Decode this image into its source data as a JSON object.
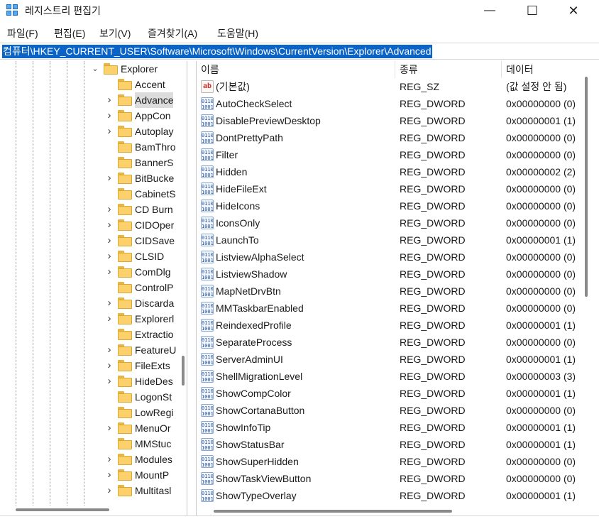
{
  "window": {
    "title": "레지스트리 편집기",
    "controls": {
      "minimize": "—",
      "maximize": "☐",
      "close": "✕"
    }
  },
  "menu": [
    "파일(F)",
    "편집(E)",
    "보기(V)",
    "즐겨찾기(A)",
    "도움말(H)"
  ],
  "address": "컴퓨터\\HKEY_CURRENT_USER\\Software\\Microsoft\\Windows\\CurrentVersion\\Explorer\\Advanced",
  "tree": {
    "parent": {
      "label": "Explorer",
      "expanded": true
    },
    "children": [
      {
        "label": "Accent",
        "expandable": false,
        "selected": false
      },
      {
        "label": "Advance",
        "expandable": true,
        "selected": true
      },
      {
        "label": "AppCon",
        "expandable": true,
        "selected": false
      },
      {
        "label": "Autoplay",
        "expandable": true,
        "selected": false
      },
      {
        "label": "BamThro",
        "expandable": false,
        "selected": false
      },
      {
        "label": "BannerS",
        "expandable": false,
        "selected": false
      },
      {
        "label": "BitBucke",
        "expandable": true,
        "selected": false
      },
      {
        "label": "CabinetS",
        "expandable": false,
        "selected": false
      },
      {
        "label": "CD Burn",
        "expandable": true,
        "selected": false
      },
      {
        "label": "CIDOper",
        "expandable": true,
        "selected": false
      },
      {
        "label": "CIDSave",
        "expandable": true,
        "selected": false
      },
      {
        "label": "CLSID",
        "expandable": true,
        "selected": false
      },
      {
        "label": "ComDlg",
        "expandable": true,
        "selected": false
      },
      {
        "label": "ControlP",
        "expandable": false,
        "selected": false
      },
      {
        "label": "Discarda",
        "expandable": true,
        "selected": false
      },
      {
        "label": "Explorerl",
        "expandable": true,
        "selected": false
      },
      {
        "label": "Extractio",
        "expandable": false,
        "selected": false
      },
      {
        "label": "FeatureU",
        "expandable": true,
        "selected": false
      },
      {
        "label": "FileExts",
        "expandable": true,
        "selected": false
      },
      {
        "label": "HideDes",
        "expandable": true,
        "selected": false
      },
      {
        "label": "LogonSt",
        "expandable": false,
        "selected": false
      },
      {
        "label": "LowRegi",
        "expandable": false,
        "selected": false
      },
      {
        "label": "MenuOr",
        "expandable": true,
        "selected": false
      },
      {
        "label": "MMStuc",
        "expandable": false,
        "selected": false
      },
      {
        "label": "Modules",
        "expandable": true,
        "selected": false
      },
      {
        "label": "MountP",
        "expandable": true,
        "selected": false
      },
      {
        "label": "Multitasl",
        "expandable": true,
        "selected": false
      }
    ]
  },
  "columns": [
    "이름",
    "종류",
    "데이터"
  ],
  "values": [
    {
      "name": "(기본값)",
      "type": "REG_SZ",
      "data": "(값 설정 안 됨)",
      "icon": "string-value-icon"
    },
    {
      "name": "AutoCheckSelect",
      "type": "REG_DWORD",
      "data": "0x00000000 (0)",
      "icon": "binary-value-icon"
    },
    {
      "name": "DisablePreviewDesktop",
      "type": "REG_DWORD",
      "data": "0x00000001 (1)",
      "icon": "binary-value-icon"
    },
    {
      "name": "DontPrettyPath",
      "type": "REG_DWORD",
      "data": "0x00000000 (0)",
      "icon": "binary-value-icon"
    },
    {
      "name": "Filter",
      "type": "REG_DWORD",
      "data": "0x00000000 (0)",
      "icon": "binary-value-icon"
    },
    {
      "name": "Hidden",
      "type": "REG_DWORD",
      "data": "0x00000002 (2)",
      "icon": "binary-value-icon"
    },
    {
      "name": "HideFileExt",
      "type": "REG_DWORD",
      "data": "0x00000000 (0)",
      "icon": "binary-value-icon"
    },
    {
      "name": "HideIcons",
      "type": "REG_DWORD",
      "data": "0x00000000 (0)",
      "icon": "binary-value-icon"
    },
    {
      "name": "IconsOnly",
      "type": "REG_DWORD",
      "data": "0x00000000 (0)",
      "icon": "binary-value-icon"
    },
    {
      "name": "LaunchTo",
      "type": "REG_DWORD",
      "data": "0x00000001 (1)",
      "icon": "binary-value-icon"
    },
    {
      "name": "ListviewAlphaSelect",
      "type": "REG_DWORD",
      "data": "0x00000000 (0)",
      "icon": "binary-value-icon"
    },
    {
      "name": "ListviewShadow",
      "type": "REG_DWORD",
      "data": "0x00000000 (0)",
      "icon": "binary-value-icon"
    },
    {
      "name": "MapNetDrvBtn",
      "type": "REG_DWORD",
      "data": "0x00000000 (0)",
      "icon": "binary-value-icon"
    },
    {
      "name": "MMTaskbarEnabled",
      "type": "REG_DWORD",
      "data": "0x00000000 (0)",
      "icon": "binary-value-icon"
    },
    {
      "name": "ReindexedProfile",
      "type": "REG_DWORD",
      "data": "0x00000001 (1)",
      "icon": "binary-value-icon"
    },
    {
      "name": "SeparateProcess",
      "type": "REG_DWORD",
      "data": "0x00000000 (0)",
      "icon": "binary-value-icon"
    },
    {
      "name": "ServerAdminUI",
      "type": "REG_DWORD",
      "data": "0x00000001 (1)",
      "icon": "binary-value-icon"
    },
    {
      "name": "ShellMigrationLevel",
      "type": "REG_DWORD",
      "data": "0x00000003 (3)",
      "icon": "binary-value-icon"
    },
    {
      "name": "ShowCompColor",
      "type": "REG_DWORD",
      "data": "0x00000001 (1)",
      "icon": "binary-value-icon"
    },
    {
      "name": "ShowCortanaButton",
      "type": "REG_DWORD",
      "data": "0x00000000 (0)",
      "icon": "binary-value-icon"
    },
    {
      "name": "ShowInfoTip",
      "type": "REG_DWORD",
      "data": "0x00000001 (1)",
      "icon": "binary-value-icon"
    },
    {
      "name": "ShowStatusBar",
      "type": "REG_DWORD",
      "data": "0x00000001 (1)",
      "icon": "binary-value-icon"
    },
    {
      "name": "ShowSuperHidden",
      "type": "REG_DWORD",
      "data": "0x00000000 (0)",
      "icon": "binary-value-icon"
    },
    {
      "name": "ShowTaskViewButton",
      "type": "REG_DWORD",
      "data": "0x00000000 (0)",
      "icon": "binary-value-icon"
    },
    {
      "name": "ShowTypeOverlay",
      "type": "REG_DWORD",
      "data": "0x00000001 (1)",
      "icon": "binary-value-icon"
    }
  ],
  "colors": {
    "accent": "#0a64c8",
    "folder": "#fcd06a",
    "selection": "#dcdcdc"
  }
}
